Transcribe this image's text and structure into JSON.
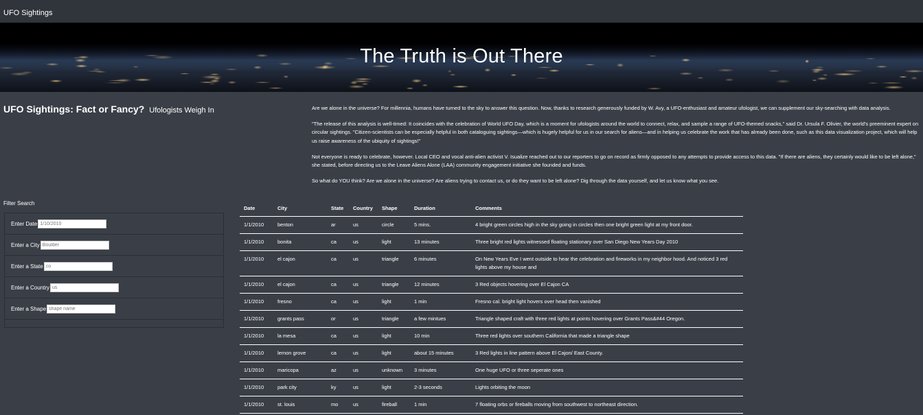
{
  "navbar": {
    "brand": "UFO Sightings"
  },
  "hero": {
    "title": "The Truth is Out There"
  },
  "headline": {
    "title": "UFO Sightings: Fact or Fancy?",
    "subtitle": "Ufologists Weigh In"
  },
  "article": {
    "paragraphs": [
      "Are we alone in the universe? For millennia, humans have turned to the sky to answer this question. Now, thanks to research generously funded by W. Avy, a UFO-enthusiast and amateur ufologist, we can supplement our sky-searching with data analysis.",
      "\"The release of this analysis is well-timed: It coincides with the celebration of World UFO Day, which is a moment for ufologists around the world to connect, relax, and sample a range of UFO-themed snacks,\" said Dr. Ursula F. Olivier, the world's preeminent expert on circular sightings. \"Citizen-scientists can be especially helpful in both cataloguing sightings—which is hugely helpful for us in our search for aliens—and in helping us celebrate the work that has already been done, such as this data visualization project, which will help us raise awareness of the ubiquity of sightings!\"",
      "Not everyone is ready to celebrate, however. Local CEO and vocal anti-alien activist V. Isualize reached out to our reporters to go on record as firmly opposed to any attempts to provide access to this data. \"If there are aliens, they certainly would like to be left alone,\" she stated, before directing us to the Leave Aliens Alone (LAA) community engagement initiative she founded and funds.",
      "So what do YOU think? Are we alone in the universe? Are aliens trying to contact us, or do they want to be left alone? Dig through the data yourself, and let us know what you see."
    ]
  },
  "filters": {
    "heading": "Filter Search",
    "date": {
      "label": "Enter Date",
      "placeholder": "1/10/2010"
    },
    "city": {
      "label": "Enter a City",
      "placeholder": "Boulder"
    },
    "state": {
      "label": "Enter a State",
      "placeholder": "co"
    },
    "country": {
      "label": "Enter a Country",
      "placeholder": "us"
    },
    "shape": {
      "label": "Enter a Shape",
      "placeholder": "shape name"
    }
  },
  "table": {
    "headers": [
      "Date",
      "City",
      "State",
      "Country",
      "Shape",
      "Duration",
      "Comments"
    ],
    "rows": [
      [
        "1/1/2010",
        "benton",
        "ar",
        "us",
        "circle",
        "5 mins.",
        "4 bright green circles high in the sky going in circles then one bright green light at my front door."
      ],
      [
        "1/1/2010",
        "bonita",
        "ca",
        "us",
        "light",
        "13 minutes",
        "Three bright red lights witnessed floating stationary over San Diego New Years Day 2010"
      ],
      [
        "1/1/2010",
        "el cajon",
        "ca",
        "us",
        "triangle",
        "6 minutes",
        "On New Years Eve I went outside to hear the celebration and fireworks in my neighbor hood. And noticed 3 red lights above my house and"
      ],
      [
        "1/1/2010",
        "el cajon",
        "ca",
        "us",
        "triangle",
        "12 minutes",
        "3 Red objects hovering over El Cajon CA"
      ],
      [
        "1/1/2010",
        "fresno",
        "ca",
        "us",
        "light",
        "1 min",
        "Fresno cal. bright light hovers over head then vanished"
      ],
      [
        "1/1/2010",
        "grants pass",
        "or",
        "us",
        "triangle",
        "a few mintues",
        "Triangle shaped craft with three red lights at points hovering over Grants Pass&#44 Oregon."
      ],
      [
        "1/1/2010",
        "la mesa",
        "ca",
        "us",
        "light",
        "10 min",
        "Three red lights over southern California that made a triangle shape"
      ],
      [
        "1/1/2010",
        "lemon grove",
        "ca",
        "us",
        "light",
        "about 15 minutes",
        "3 Red lights in line pattern above El Cajon/ East County."
      ],
      [
        "1/1/2010",
        "maricopa",
        "az",
        "us",
        "unknown",
        "3 minutes",
        "One huge UFO or three seperate ones"
      ],
      [
        "1/1/2010",
        "park city",
        "ky",
        "us",
        "light",
        "2-3 seconds",
        "Lights orbiting the moon"
      ],
      [
        "1/1/2010",
        "st. louis",
        "mo",
        "us",
        "fireball",
        "1 min",
        "7 floating orbs or fireballs moving from southwest to northeast direction."
      ]
    ]
  }
}
